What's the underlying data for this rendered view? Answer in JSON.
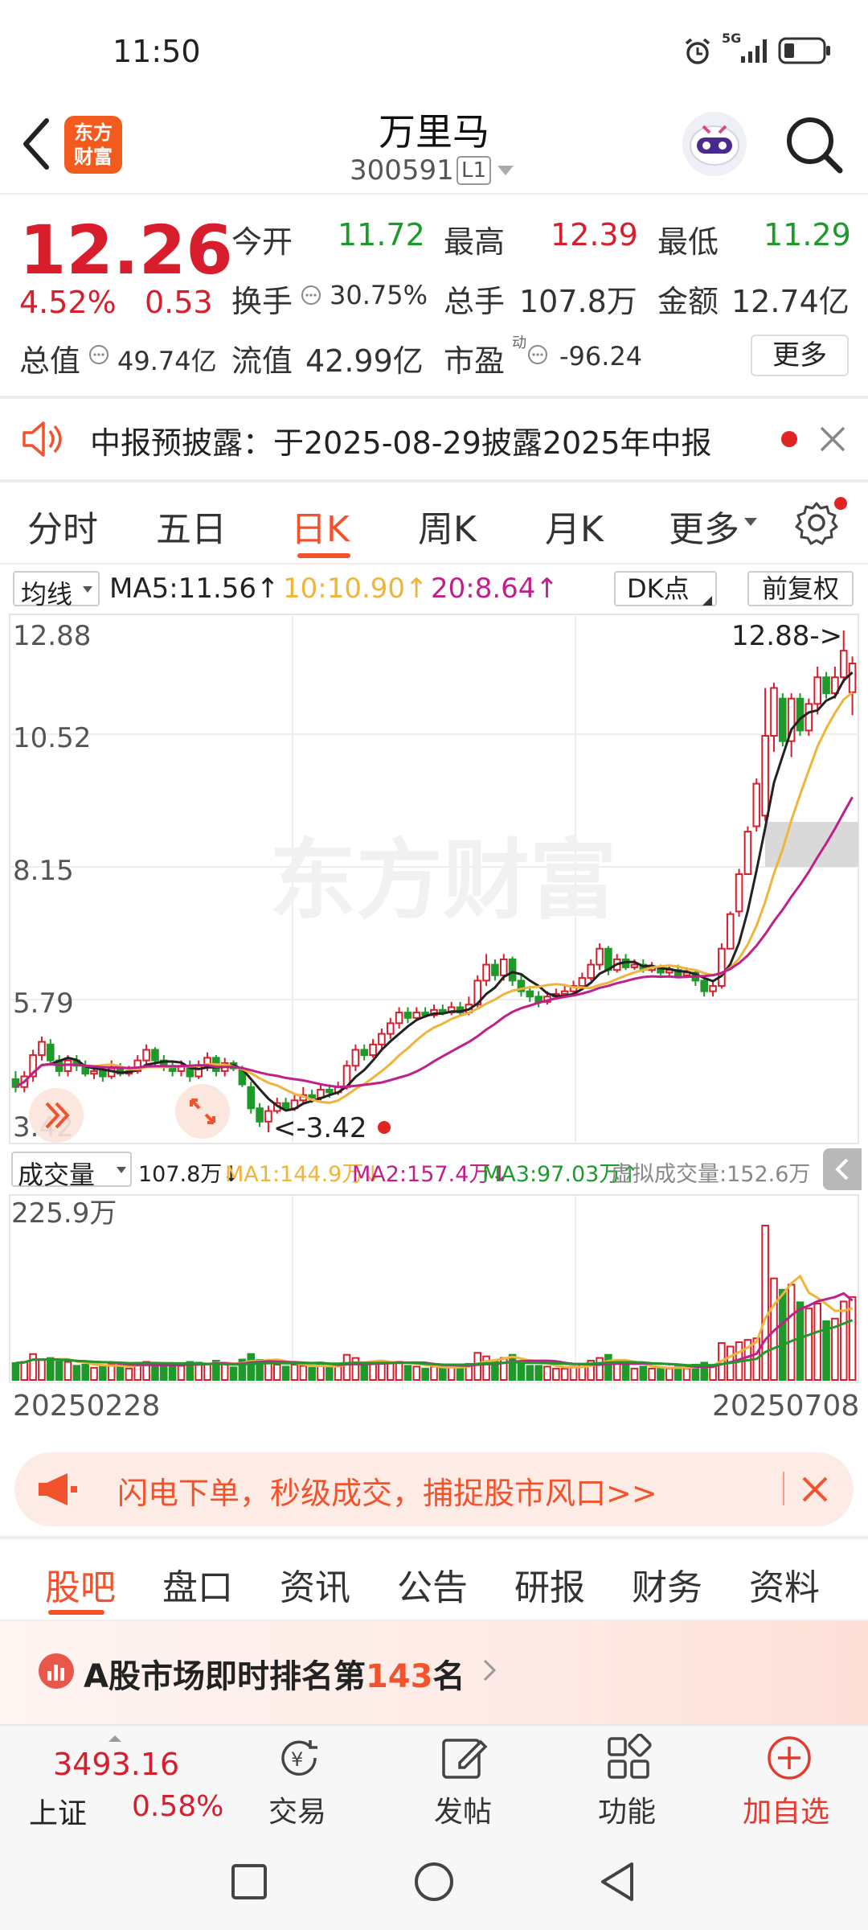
{
  "status": {
    "time": "11:50",
    "signal": "5G"
  },
  "header": {
    "title": "万里马",
    "code": "300591",
    "level": "L1",
    "logo_text": "东方\n财富"
  },
  "quote": {
    "price": "12.26",
    "change_pct": "4.52%",
    "change": "0.53",
    "open_label": "今开",
    "open": "11.72",
    "high_label": "最高",
    "high": "12.39",
    "low_label": "最低",
    "low": "11.29",
    "turnover_label": "换手",
    "turnover": "30.75%",
    "volume_label": "总手",
    "volume": "107.8万",
    "amount_label": "金额",
    "amount": "12.74亿",
    "mktcap_label": "总值",
    "mktcap": "49.74亿",
    "float_label": "流值",
    "float": "42.99亿",
    "pe_label": "市盈",
    "pe_sup": "动",
    "pe": "-96.24",
    "more_button": "更多"
  },
  "notice": {
    "text": "中报预披露：于2025-08-29披露2025年中报"
  },
  "period_tabs": [
    "分时",
    "五日",
    "日K",
    "周K",
    "月K",
    "更多"
  ],
  "active_period": 2,
  "ma_bar": {
    "selector": "均线",
    "ma5": "MA5:11.56↑",
    "ma10": "10:10.90↑",
    "ma20": "20:8.64↑",
    "dk_button": "DK点",
    "adjust_button": "前复权"
  },
  "price_axis": {
    "labels": [
      "12.88",
      "10.52",
      "8.15",
      "5.79",
      "3.42"
    ],
    "max_annot": "12.88->",
    "min_annot": "<-3.42"
  },
  "watermark": "东方财富",
  "volume_bar": {
    "selector": "成交量",
    "vol": "107.8万↓",
    "ma1": "MA1:144.9万↓",
    "ma2": "MA2:157.4万↓",
    "ma3": "MA3:97.03万↑",
    "virtual": "虚拟成交量:152.6万",
    "max_label": "225.9万"
  },
  "date_range": {
    "start": "20250228",
    "end": "20250708"
  },
  "promo": {
    "text": "闪电下单，秒级成交，捕捉股市风口>>"
  },
  "info_tabs": [
    "股吧",
    "盘口",
    "资讯",
    "公告",
    "研报",
    "财务",
    "资料"
  ],
  "active_info_tab": 0,
  "ranking": {
    "prefix": "A股市场即时排名第",
    "rank": "143",
    "suffix": "名"
  },
  "index": {
    "value": "3493.16",
    "name": "上证",
    "change": "0.58%"
  },
  "bottom_nav": [
    "交易",
    "发帖",
    "功能",
    "加自选"
  ],
  "colors": {
    "up": "#d81e2c",
    "down": "#1e9a2b",
    "accent": "#f2522c",
    "ma5": "#222222",
    "ma10": "#f0b43c",
    "ma20": "#c0208a"
  },
  "chart_data": {
    "type": "candlestick",
    "ylim": [
      3.42,
      12.88
    ],
    "y_ticks": [
      12.88,
      10.52,
      8.15,
      5.79,
      3.42
    ],
    "x_range": [
      "20250228",
      "20250708"
    ],
    "candles": [
      [
        4.45,
        4.3,
        4.6,
        4.2
      ],
      [
        4.3,
        4.5,
        4.6,
        4.2
      ],
      [
        4.5,
        4.9,
        5.0,
        4.4
      ],
      [
        4.9,
        5.15,
        5.25,
        4.8
      ],
      [
        5.1,
        4.8,
        5.2,
        4.7
      ],
      [
        4.8,
        4.6,
        4.9,
        4.5
      ],
      [
        4.6,
        4.8,
        4.9,
        4.5
      ],
      [
        4.8,
        4.7,
        4.9,
        4.6
      ],
      [
        4.7,
        4.55,
        4.8,
        4.5
      ],
      [
        4.55,
        4.6,
        4.7,
        4.45
      ],
      [
        4.6,
        4.5,
        4.7,
        4.4
      ],
      [
        4.5,
        4.65,
        4.8,
        4.45
      ],
      [
        4.65,
        4.55,
        4.75,
        4.5
      ],
      [
        4.55,
        4.6,
        4.7,
        4.5
      ],
      [
        4.6,
        4.8,
        4.9,
        4.55
      ],
      [
        4.8,
        5.0,
        5.1,
        4.7
      ],
      [
        5.0,
        4.8,
        5.05,
        4.7
      ],
      [
        4.8,
        4.7,
        4.9,
        4.6
      ],
      [
        4.7,
        4.6,
        4.8,
        4.5
      ],
      [
        4.6,
        4.7,
        4.8,
        4.5
      ],
      [
        4.7,
        4.5,
        4.8,
        4.4
      ],
      [
        4.5,
        4.7,
        4.8,
        4.45
      ],
      [
        4.7,
        4.85,
        4.95,
        4.6
      ],
      [
        4.85,
        4.6,
        4.9,
        4.5
      ],
      [
        4.6,
        4.75,
        4.85,
        4.5
      ],
      [
        4.75,
        4.65,
        4.8,
        4.6
      ],
      [
        4.65,
        4.35,
        4.7,
        4.3
      ],
      [
        4.3,
        3.9,
        4.4,
        3.8
      ],
      [
        3.9,
        3.65,
        4.0,
        3.55
      ],
      [
        3.65,
        3.85,
        3.95,
        3.45
      ],
      [
        3.85,
        4.0,
        4.1,
        3.8
      ],
      [
        4.0,
        3.9,
        4.1,
        3.85
      ],
      [
        3.9,
        4.05,
        4.15,
        3.85
      ],
      [
        4.05,
        4.15,
        4.3,
        4.0
      ],
      [
        4.15,
        4.1,
        4.25,
        4.0
      ],
      [
        4.1,
        4.25,
        4.35,
        4.05
      ],
      [
        4.25,
        4.2,
        4.35,
        4.1
      ],
      [
        4.2,
        4.3,
        4.4,
        4.15
      ],
      [
        4.3,
        4.7,
        4.8,
        4.25
      ],
      [
        4.7,
        5.0,
        5.1,
        4.6
      ],
      [
        5.0,
        4.9,
        5.1,
        4.8
      ],
      [
        4.9,
        5.1,
        5.2,
        4.85
      ],
      [
        5.1,
        5.3,
        5.4,
        5.0
      ],
      [
        5.3,
        5.5,
        5.6,
        5.2
      ],
      [
        5.5,
        5.7,
        5.8,
        5.4
      ],
      [
        5.7,
        5.6,
        5.8,
        5.5
      ],
      [
        5.6,
        5.7,
        5.8,
        5.55
      ],
      [
        5.7,
        5.65,
        5.8,
        5.6
      ],
      [
        5.65,
        5.75,
        5.85,
        5.6
      ],
      [
        5.75,
        5.7,
        5.85,
        5.65
      ],
      [
        5.7,
        5.8,
        5.9,
        5.65
      ],
      [
        5.8,
        5.7,
        5.9,
        5.65
      ],
      [
        5.7,
        5.85,
        6.0,
        5.65
      ],
      [
        5.85,
        6.3,
        6.4,
        5.8
      ],
      [
        6.3,
        6.6,
        6.8,
        6.2
      ],
      [
        6.6,
        6.4,
        6.7,
        6.3
      ],
      [
        6.4,
        6.7,
        6.8,
        6.3
      ],
      [
        6.7,
        6.3,
        6.75,
        6.2
      ],
      [
        6.3,
        6.1,
        6.4,
        6.0
      ],
      [
        6.1,
        6.0,
        6.2,
        5.9
      ],
      [
        6.0,
        5.9,
        6.1,
        5.8
      ],
      [
        5.9,
        6.0,
        6.1,
        5.85
      ],
      [
        6.0,
        6.05,
        6.15,
        5.95
      ],
      [
        6.05,
        6.1,
        6.2,
        6.0
      ],
      [
        6.1,
        6.2,
        6.3,
        6.05
      ],
      [
        6.2,
        6.35,
        6.45,
        6.15
      ],
      [
        6.35,
        6.6,
        6.7,
        6.3
      ],
      [
        6.6,
        6.9,
        7.0,
        6.5
      ],
      [
        6.9,
        6.5,
        6.95,
        6.4
      ],
      [
        6.5,
        6.7,
        6.8,
        6.45
      ],
      [
        6.7,
        6.55,
        6.8,
        6.5
      ],
      [
        6.55,
        6.6,
        6.7,
        6.5
      ],
      [
        6.6,
        6.5,
        6.7,
        6.45
      ],
      [
        6.5,
        6.55,
        6.65,
        6.45
      ],
      [
        6.55,
        6.45,
        6.6,
        6.4
      ],
      [
        6.45,
        6.5,
        6.6,
        6.4
      ],
      [
        6.5,
        6.4,
        6.6,
        6.35
      ],
      [
        6.4,
        6.45,
        6.55,
        6.35
      ],
      [
        6.45,
        6.3,
        6.5,
        6.2
      ],
      [
        6.3,
        6.1,
        6.35,
        6.0
      ],
      [
        6.1,
        6.2,
        6.3,
        6.0
      ],
      [
        6.2,
        6.9,
        7.0,
        6.15
      ],
      [
        6.9,
        7.55,
        7.6,
        6.9
      ],
      [
        7.6,
        8.3,
        8.4,
        7.5
      ],
      [
        8.3,
        9.1,
        9.2,
        8.3
      ],
      [
        9.2,
        10.0,
        10.1,
        9.1
      ],
      [
        9.4,
        10.9,
        11.8,
        9.3
      ],
      [
        10.9,
        11.8,
        11.9,
        10.6
      ],
      [
        11.6,
        10.8,
        11.7,
        10.7
      ],
      [
        10.8,
        11.6,
        11.7,
        10.5
      ],
      [
        11.6,
        11.0,
        11.7,
        10.9
      ],
      [
        11.0,
        11.5,
        11.6,
        10.9
      ],
      [
        11.5,
        12.0,
        12.2,
        11.3
      ],
      [
        12.0,
        11.7,
        12.1,
        11.6
      ],
      [
        11.7,
        12.0,
        12.2,
        11.6
      ],
      [
        12.0,
        12.5,
        12.88,
        11.9
      ],
      [
        11.72,
        12.26,
        12.39,
        11.29
      ]
    ],
    "ma_values": {
      "MA5": 11.56,
      "MA10": 10.9,
      "MA20": 8.64
    },
    "volume": {
      "last": "107.8万",
      "MA1": "144.9万",
      "MA2": "157.4万",
      "MA3": "97.03万",
      "max": "225.9万"
    }
  }
}
